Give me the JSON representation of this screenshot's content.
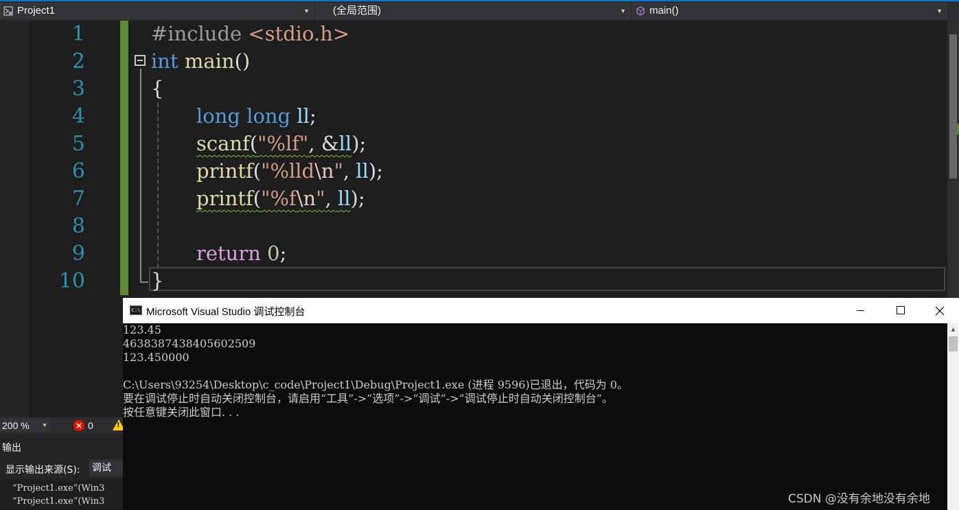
{
  "navbar": {
    "project": "Project1",
    "scope": "(全局范围)",
    "member": "main()"
  },
  "editor": {
    "line_numbers": [
      "1",
      "2",
      "3",
      "4",
      "5",
      "6",
      "7",
      "8",
      "9",
      "10"
    ],
    "lines": {
      "l1_directive": "#include",
      "l1_header": "<stdio.h>",
      "l2_kw": "int",
      "l2_fn": "main",
      "l2_rest": "()",
      "l3": "{",
      "l4_kw": "long long",
      "l4_var": "ll",
      "l4_end": ";",
      "l5_fn": "scanf",
      "l5_open": "(",
      "l5_str": "\"%lf\"",
      "l5_sep": ", &",
      "l5_var": "ll",
      "l5_end": ");",
      "l6_fn": "printf",
      "l6_open": "(",
      "l6_str1": "\"%lld",
      "l6_esc": "\\n",
      "l6_str2": "\"",
      "l6_sep": ", ",
      "l6_var": "ll",
      "l6_end": ");",
      "l7_fn": "printf",
      "l7_open": "(",
      "l7_str1": "\"%f",
      "l7_esc": "\\n",
      "l7_str2": "\"",
      "l7_sep": ", ",
      "l7_var": "ll",
      "l7_end": ");",
      "l9_kw": "return",
      "l9_num": "0",
      "l9_end": ";",
      "l10": "}"
    }
  },
  "status": {
    "zoom": "200 %",
    "errors": "0"
  },
  "output_pane": {
    "title": "输出",
    "source_label": "显示输出来源(S):",
    "source_value": "调试",
    "lines": [
      "“Project1.exe”(Win3",
      "“Project1.exe”(Win3"
    ]
  },
  "console": {
    "icon_text": "C:\\",
    "title": "Microsoft Visual Studio 调试控制台",
    "lines": [
      "123.45",
      "4638387438405602509",
      "123.450000",
      "",
      "C:\\Users\\93254\\Desktop\\c_code\\Project1\\Debug\\Project1.exe (进程 9596)已退出，代码为 0。",
      "要在调试停止时自动关闭控制台，请启用“工具”->“选项”->“调试”->“调试停止时自动关闭控制台”。",
      "按任意键关闭此窗口. . ."
    ]
  },
  "watermark": "CSDN @没有余地没有余地"
}
